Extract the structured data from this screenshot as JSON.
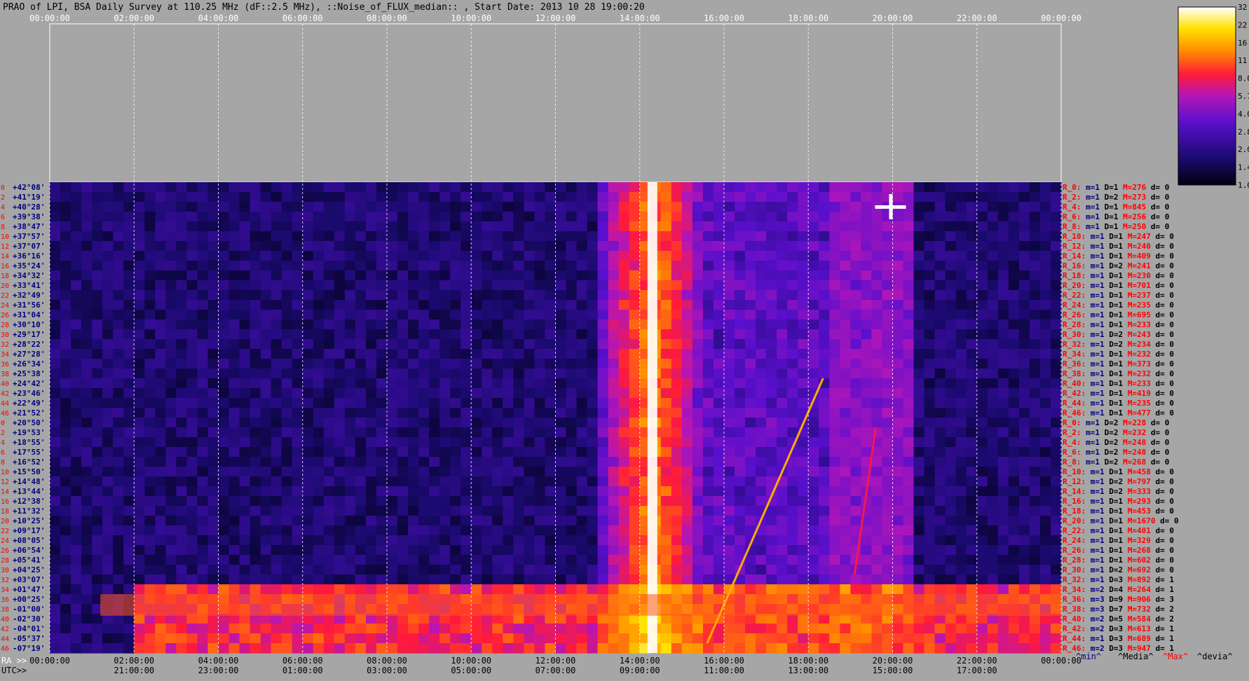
{
  "chart_data": {
    "type": "heatmap",
    "title": "PRAO of LPI, BSA Daily Survey at 110.25 MHz (dF::2.5 MHz), ::Noise_of_FLUX_median:: , Start Date: 2013 10 28 19:00:20",
    "top_time_ticks": [
      "00:00:00",
      "02:00:00",
      "04:00:00",
      "06:00:00",
      "08:00:00",
      "10:00:00",
      "12:00:00",
      "14:00:00",
      "16:00:00",
      "18:00:00",
      "20:00:00",
      "22:00:00",
      "00:00:00"
    ],
    "bottom_ra_prefix": "RA >>",
    "bottom_ra_ticks": [
      "00:00:00",
      "02:00:00",
      "04:00:00",
      "06:00:00",
      "08:00:00",
      "10:00:00",
      "12:00:00",
      "14:00:00",
      "16:00:00",
      "18:00:00",
      "20:00:00",
      "22:00:00",
      "00:00:00"
    ],
    "bottom_utc_prefix": "UTC>>",
    "bottom_utc_ticks": [
      "21:00:00",
      "23:00:00",
      "01:00:00",
      "03:00:00",
      "05:00:00",
      "07:00:00",
      "09:00:00",
      "11:00:00",
      "13:00:00",
      "15:00:00",
      "17:00:00"
    ],
    "declinations": [
      "+42°08'",
      "+41°19'",
      "+40°28'",
      "+39°38'",
      "+38°47'",
      "+37°57'",
      "+37°07'",
      "+36°16'",
      "+35°24'",
      "+34°32'",
      "+33°41'",
      "+32°49'",
      "+31°56'",
      "+31°04'",
      "+30°10'",
      "+29°17'",
      "+28°22'",
      "+27°28'",
      "+26°34'",
      "+25°38'",
      "+24°42'",
      "+23°46'",
      "+22°49'",
      "+21°52'",
      "+20°50'",
      "+19°53'",
      "+18°55'",
      "+17°55'",
      "+16°52'",
      "+15°50'",
      "+14°48'",
      "+13°44'",
      "+12°38'",
      "+11°32'",
      "+10°25'",
      "+09°17'",
      "+08°05'",
      "+06°54'",
      "+05°41'",
      "+04°25'",
      "+03°07'",
      "+01°47'",
      "+00°25'",
      "-01°00'",
      "-02°30'",
      "-04°01'",
      "-05°37'",
      "-07°19'"
    ],
    "beam_numbers": [
      "0",
      "2",
      "4",
      "6",
      "8",
      "10",
      "12",
      "14",
      "16",
      "18",
      "20",
      "22",
      "24",
      "26",
      "28",
      "30",
      "32",
      "34",
      "36",
      "38",
      "40",
      "42",
      "44",
      "46",
      "0",
      "2",
      "4",
      "6",
      "8",
      "10",
      "12",
      "14",
      "16",
      "18",
      "20",
      "22",
      "24",
      "26",
      "28",
      "30",
      "32",
      "34",
      "36",
      "38",
      "40",
      "42",
      "44",
      "46"
    ],
    "receivers": [
      {
        "r": "R_0:",
        "m": "m=1",
        "D": "D=1",
        "M": "M=276",
        "d": "d= 0"
      },
      {
        "r": "R_2:",
        "m": "m=1",
        "D": "D=2",
        "M": "M=273",
        "d": "d= 0"
      },
      {
        "r": "R_4:",
        "m": "m=1",
        "D": "D=1",
        "M": "M=845",
        "d": "d= 0"
      },
      {
        "r": "R_6:",
        "m": "m=1",
        "D": "D=1",
        "M": "M=256",
        "d": "d= 0"
      },
      {
        "r": "R_8:",
        "m": "m=1",
        "D": "D=1",
        "M": "M=250",
        "d": "d= 0"
      },
      {
        "r": "R_10:",
        "m": "m=1",
        "D": "D=1",
        "M": "M=247",
        "d": "d= 0"
      },
      {
        "r": "R_12:",
        "m": "m=1",
        "D": "D=1",
        "M": "M=240",
        "d": "d= 0"
      },
      {
        "r": "R_14:",
        "m": "m=1",
        "D": "D=1",
        "M": "M=409",
        "d": "d= 0"
      },
      {
        "r": "R_16:",
        "m": "m=1",
        "D": "D=2",
        "M": "M=241",
        "d": "d= 0"
      },
      {
        "r": "R_18:",
        "m": "m=1",
        "D": "D=1",
        "M": "M=230",
        "d": "d= 0"
      },
      {
        "r": "R_20:",
        "m": "m=1",
        "D": "D=1",
        "M": "M=701",
        "d": "d= 0"
      },
      {
        "r": "R_22:",
        "m": "m=1",
        "D": "D=1",
        "M": "M=237",
        "d": "d= 0"
      },
      {
        "r": "R_24:",
        "m": "m=1",
        "D": "D=1",
        "M": "M=235",
        "d": "d= 0"
      },
      {
        "r": "R_26:",
        "m": "m=1",
        "D": "D=1",
        "M": "M=695",
        "d": "d= 0"
      },
      {
        "r": "R_28:",
        "m": "m=1",
        "D": "D=1",
        "M": "M=233",
        "d": "d= 0"
      },
      {
        "r": "R_30:",
        "m": "m=1",
        "D": "D=2",
        "M": "M=243",
        "d": "d= 0"
      },
      {
        "r": "R_32:",
        "m": "m=1",
        "D": "D=2",
        "M": "M=234",
        "d": "d= 0"
      },
      {
        "r": "R_34:",
        "m": "m=1",
        "D": "D=1",
        "M": "M=232",
        "d": "d= 0"
      },
      {
        "r": "R_36:",
        "m": "m=1",
        "D": "D=1",
        "M": "M=373",
        "d": "d= 0"
      },
      {
        "r": "R_38:",
        "m": "m=1",
        "D": "D=1",
        "M": "M=232",
        "d": "d= 0"
      },
      {
        "r": "R_40:",
        "m": "m=1",
        "D": "D=1",
        "M": "M=233",
        "d": "d= 0"
      },
      {
        "r": "R_42:",
        "m": "m=1",
        "D": "D=1",
        "M": "M=419",
        "d": "d= 0"
      },
      {
        "r": "R_44:",
        "m": "m=1",
        "D": "D=1",
        "M": "M=235",
        "d": "d= 0"
      },
      {
        "r": "R_46:",
        "m": "m=1",
        "D": "D=1",
        "M": "M=477",
        "d": "d= 0"
      },
      {
        "r": "R_0:",
        "m": "m=1",
        "D": "D=2",
        "M": "M=228",
        "d": "d= 0"
      },
      {
        "r": "R_2:",
        "m": "m=1",
        "D": "D=2",
        "M": "M=232",
        "d": "d= 0"
      },
      {
        "r": "R_4:",
        "m": "m=1",
        "D": "D=2",
        "M": "M=248",
        "d": "d= 0"
      },
      {
        "r": "R_6:",
        "m": "m=1",
        "D": "D=2",
        "M": "M=248",
        "d": "d= 0"
      },
      {
        "r": "R_8:",
        "m": "m=1",
        "D": "D=2",
        "M": "M=268",
        "d": "d= 0"
      },
      {
        "r": "R_10:",
        "m": "m=1",
        "D": "D=1",
        "M": "M=458",
        "d": "d= 0"
      },
      {
        "r": "R_12:",
        "m": "m=1",
        "D": "D=2",
        "M": "M=797",
        "d": "d= 0"
      },
      {
        "r": "R_14:",
        "m": "m=1",
        "D": "D=2",
        "M": "M=333",
        "d": "d= 0"
      },
      {
        "r": "R_16:",
        "m": "m=1",
        "D": "D=1",
        "M": "M=293",
        "d": "d= 0"
      },
      {
        "r": "R_18:",
        "m": "m=1",
        "D": "D=1",
        "M": "M=453",
        "d": "d= 0"
      },
      {
        "r": "R_20:",
        "m": "m=1",
        "D": "D=1",
        "M": "M=1670",
        "d": "d= 0"
      },
      {
        "r": "R_22:",
        "m": "m=1",
        "D": "D=1",
        "M": "M=401",
        "d": "d= 0"
      },
      {
        "r": "R_24:",
        "m": "m=1",
        "D": "D=1",
        "M": "M=329",
        "d": "d= 0"
      },
      {
        "r": "R_26:",
        "m": "m=1",
        "D": "D=1",
        "M": "M=268",
        "d": "d= 0"
      },
      {
        "r": "R_28:",
        "m": "m=1",
        "D": "D=1",
        "M": "M=602",
        "d": "d= 0"
      },
      {
        "r": "R_30:",
        "m": "m=1",
        "D": "D=2",
        "M": "M=692",
        "d": "d= 0"
      },
      {
        "r": "R_32:",
        "m": "m=1",
        "D": "D=3",
        "M": "M=892",
        "d": "d= 1"
      },
      {
        "r": "R_34:",
        "m": "m=2",
        "D": "D=4",
        "M": "M=264",
        "d": "d= 1"
      },
      {
        "r": "R_36:",
        "m": "m=3",
        "D": "D=9",
        "M": "M=906",
        "d": "d= 3"
      },
      {
        "r": "R_38:",
        "m": "m=3",
        "D": "D=7",
        "M": "M=732",
        "d": "d= 2"
      },
      {
        "r": "R_40:",
        "m": "m=2",
        "D": "D=5",
        "M": "M=584",
        "d": "d= 2"
      },
      {
        "r": "R_42:",
        "m": "m=2",
        "D": "D=3",
        "M": "M=613",
        "d": "d= 1"
      },
      {
        "r": "R_44:",
        "m": "m=1",
        "D": "D=3",
        "M": "M=689",
        "d": "d= 1"
      },
      {
        "r": "R_46:",
        "m": "m=2",
        "D": "D=3",
        "M": "M=947",
        "d": "d= 1"
      }
    ],
    "legend_footer": {
      "min": "^min^",
      "media": "^Media^",
      "max": "^Max^",
      "devia": "^devia^"
    },
    "colorbar": {
      "scale": "log",
      "ticks": [
        "32.0",
        "22.6",
        "16.0",
        "11.3",
        "8.0",
        "5.7",
        "4.0",
        "2.8",
        "2.0",
        "1.4",
        "1.0"
      ]
    },
    "features": [
      {
        "kind": "vertical-band",
        "ra_hours": 14.3,
        "intensity": 32
      },
      {
        "kind": "horizontal-band",
        "dec_rows": [
          41,
          47
        ],
        "intensity": 11
      },
      {
        "kind": "diagonal-track",
        "from": [
          15.6,
          47
        ],
        "to": [
          18.35,
          20
        ],
        "intensity": 16
      },
      {
        "kind": "diagonal-track",
        "from": [
          19.1,
          40
        ],
        "to": [
          19.6,
          25
        ],
        "intensity": 8
      },
      {
        "kind": "point-source",
        "ra_hours": 19.95,
        "dec_row": 2,
        "intensity": 32
      }
    ],
    "colors": {
      "background": "#a6a6a6",
      "title": "#000000",
      "declination_labels": "#000080",
      "beam_labels": "#ff0000",
      "receiver_label": "#ff0000",
      "min_label": "#000080",
      "max_label": "#ff0000"
    }
  }
}
